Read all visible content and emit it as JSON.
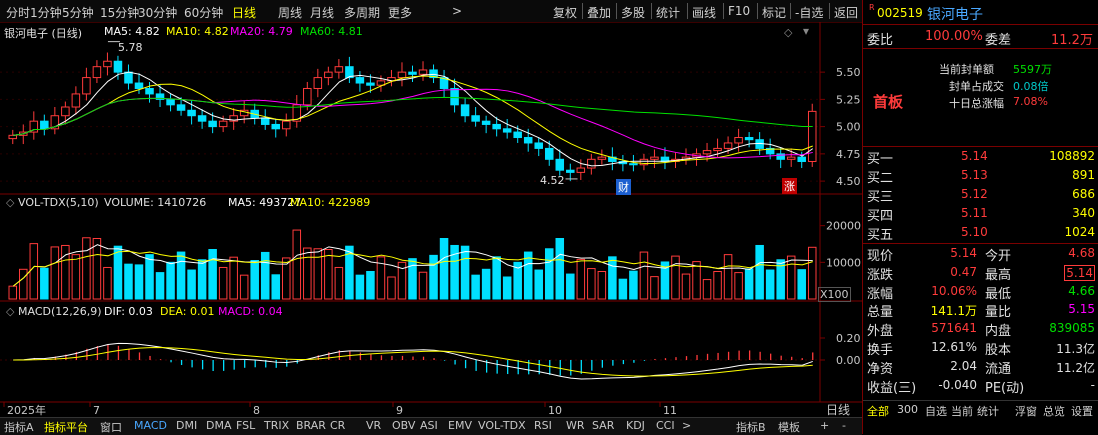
{
  "toolbar": {
    "items": [
      "分时",
      "1分钟",
      "5分钟",
      "15分钟",
      "30分钟",
      "60分钟",
      "日线",
      "周线",
      "月线",
      "多周期",
      "更多"
    ],
    "selected": "日线",
    "more_arrow": ">",
    "right_items": [
      "复权",
      "叠加",
      "多股",
      "统计",
      "画线",
      "F10",
      "标记",
      "-自选",
      "返回"
    ]
  },
  "kline_header": {
    "name": "银河电子 (日线)",
    "ma5": "MA5: 4.82",
    "ma10": "MA10: 4.82",
    "ma20": "MA20: 4.79",
    "ma60": "MA60: 4.81",
    "high_mark": "5.78",
    "low_mark": "4.52",
    "event_badge": "财",
    "limit_badge": "涨"
  },
  "vol_header": {
    "name": "VOL-TDX(5,10)",
    "volume": "VOLUME: 1410726",
    "ma5": "MA5: 493727",
    "ma10": "MA10: 422989",
    "unit": "X100"
  },
  "macd_header": {
    "name": "MACD(12,26,9)",
    "dif": "DIF: 0.03",
    "dea": "DEA: 0.01",
    "macd": "MACD: 0.04"
  },
  "time_axis": [
    "2025年",
    "7",
    "8",
    "9",
    "10",
    "11"
  ],
  "axis_period": "日线",
  "bottom_tabs": [
    "指标A",
    "指标平台",
    "窗口",
    "MACD",
    "DMI",
    "DMA",
    "FSL",
    "TRIX",
    "BRAR",
    "CR",
    "VR",
    "OBV",
    "ASI",
    "EMV",
    "VOL-TDX",
    "RSI",
    "WR",
    "SAR",
    "KDJ",
    "CCI",
    ">",
    "指标B",
    "模板",
    "+",
    "-"
  ],
  "right_panel": {
    "code": "002519",
    "name": "银河电子",
    "r_mark": "R",
    "weibi_label": "委比",
    "weibi": "100.00%",
    "weicha_label": "委差",
    "weicha": "11.2万",
    "seal_amount_label": "当前封单额",
    "seal_amount": "5597万",
    "seal_ratio_label": "封单占成交",
    "seal_ratio": "0.08倍",
    "ten_day_label": "十日总涨幅",
    "ten_day": "7.08%",
    "first_board": "首板",
    "bids": [
      {
        "label": "买一",
        "price": "5.14",
        "vol": "108892"
      },
      {
        "label": "买二",
        "price": "5.13",
        "vol": "891"
      },
      {
        "label": "买三",
        "price": "5.12",
        "vol": "686"
      },
      {
        "label": "买四",
        "price": "5.11",
        "vol": "340"
      },
      {
        "label": "买五",
        "price": "5.10",
        "vol": "1024"
      }
    ],
    "quote": [
      {
        "l1": "现价",
        "v1": "5.14",
        "l2": "今开",
        "v2": "4.68"
      },
      {
        "l1": "涨跌",
        "v1": "0.47",
        "l2": "最高",
        "v2": "5.14"
      },
      {
        "l1": "涨幅",
        "v1": "10.06%",
        "l2": "最低",
        "v2": "4.66"
      },
      {
        "l1": "总量",
        "v1": "141.1万",
        "l2": "量比",
        "v2": "5.15"
      },
      {
        "l1": "外盘",
        "v1": "571641",
        "l2": "内盘",
        "v2": "839085"
      },
      {
        "l1": "换手",
        "v1": "12.61%",
        "l2": "股本",
        "v2": "11.3亿"
      },
      {
        "l1": "净资",
        "v1": "2.04",
        "l2": "流通",
        "v2": "11.2亿"
      },
      {
        "l1": "收益(三)",
        "v1": "-0.040",
        "l2": "PE(动)",
        "v2": "-"
      }
    ],
    "bottom_tabs": [
      "全部",
      "300",
      "自选",
      "当前",
      "统计",
      "浮窗",
      "总览",
      "设置"
    ]
  },
  "colors": {
    "up": "#ff3b3b",
    "down": "#00e0ff",
    "ma5": "#ffffff",
    "ma10": "#ffff00",
    "ma20": "#ff00ff",
    "ma60": "#00e000"
  },
  "chart_data": [
    {
      "type": "candlestick",
      "title": "银河电子 (日线)",
      "y_ticks": [
        4.5,
        4.75,
        5.0,
        5.25,
        5.5
      ],
      "ylim": [
        4.4,
        5.85
      ],
      "series_close": [
        4.92,
        4.95,
        5.05,
        4.98,
        5.1,
        5.18,
        5.3,
        5.45,
        5.55,
        5.6,
        5.5,
        5.4,
        5.35,
        5.3,
        5.25,
        5.2,
        5.15,
        5.1,
        5.05,
        5.0,
        5.05,
        5.1,
        5.15,
        5.08,
        5.02,
        4.98,
        5.05,
        5.2,
        5.35,
        5.45,
        5.5,
        5.55,
        5.45,
        5.4,
        5.38,
        5.42,
        5.45,
        5.5,
        5.48,
        5.52,
        5.45,
        5.35,
        5.2,
        5.1,
        5.05,
        5.02,
        4.98,
        4.95,
        4.9,
        4.85,
        4.8,
        4.7,
        4.6,
        4.58,
        4.62,
        4.7,
        4.72,
        4.68,
        4.66,
        4.65,
        4.7,
        4.72,
        4.68,
        4.7,
        4.72,
        4.75,
        4.78,
        4.8,
        4.85,
        4.9,
        4.88,
        4.8,
        4.75,
        4.7,
        4.72,
        4.68,
        5.14
      ],
      "markers": {
        "high": 5.78,
        "low": 4.52
      }
    },
    {
      "type": "bar",
      "title": "VOL-TDX(5,10)",
      "y_ticks": [
        10000,
        20000
      ],
      "unit": "X100",
      "last_volume": 1410726,
      "ma5": 493727,
      "ma10": 422989
    },
    {
      "type": "bar",
      "title": "MACD(12,26,9)",
      "y_ticks": [
        0.0,
        0.2
      ],
      "dif": 0.03,
      "dea": 0.01,
      "macd": 0.04
    }
  ]
}
